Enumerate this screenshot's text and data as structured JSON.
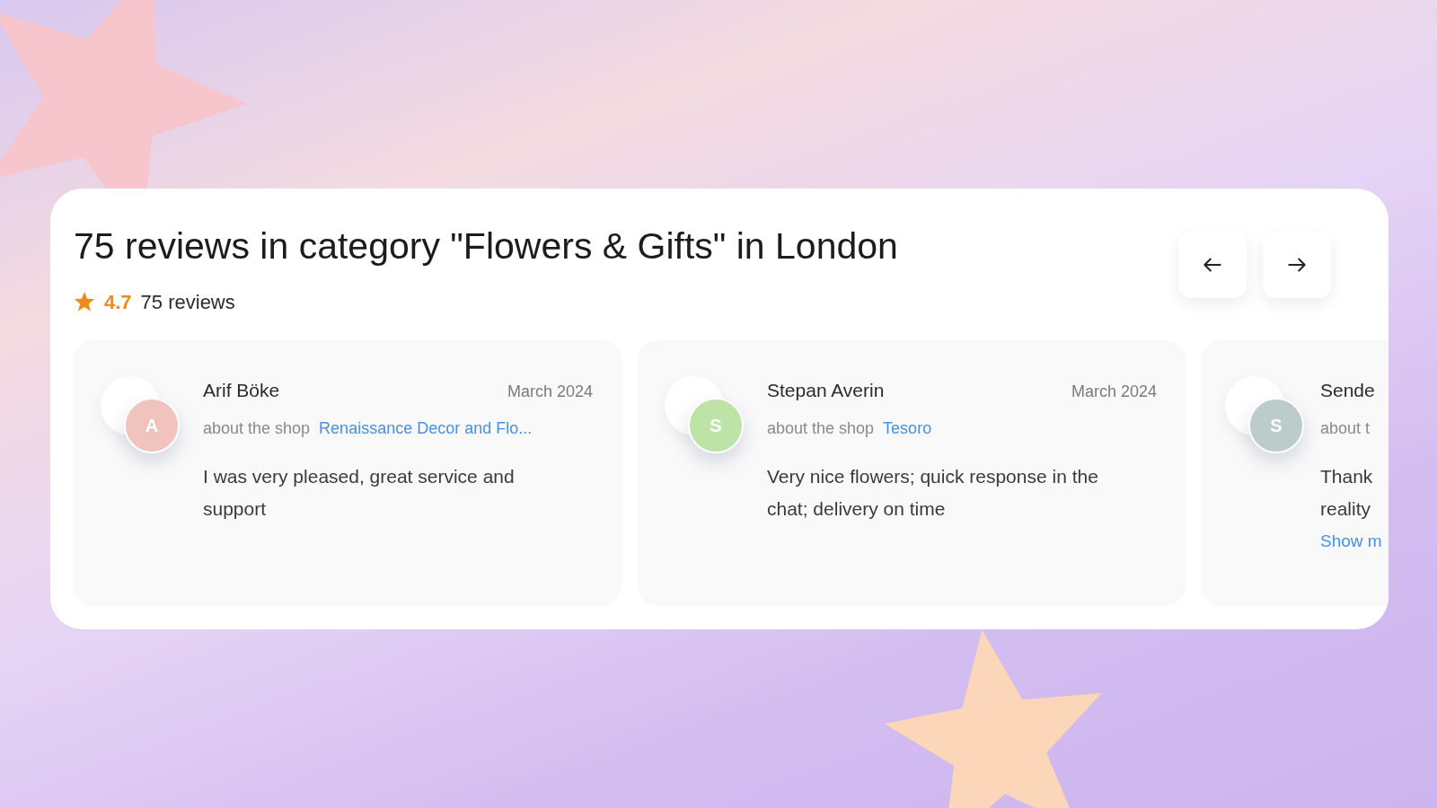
{
  "title": "75 reviews in category \"Flowers & Gifts\" in London",
  "rating": {
    "value": "4.7",
    "count": "75 reviews"
  },
  "reviews": [
    {
      "initial": "A",
      "color": "#f0c3bd",
      "name": "Arif Böke",
      "date": "March 2024",
      "about": "about the shop",
      "shop": "Renaissance Decor and Flo...",
      "lines": [
        "I was very pleased, great service and",
        "support"
      ]
    },
    {
      "initial": "S",
      "color": "#bde3a6",
      "name": "Stepan Averin",
      "date": "March 2024",
      "about": "about the shop",
      "shop": "Tesoro",
      "lines": [
        "Very nice flowers; quick response in the",
        "chat; delivery on time"
      ]
    },
    {
      "initial": "S",
      "color": "#bccbcc",
      "name": "Sende",
      "about": "about t",
      "lines": [
        "Thank",
        "reality"
      ],
      "more": "Show m"
    }
  ]
}
